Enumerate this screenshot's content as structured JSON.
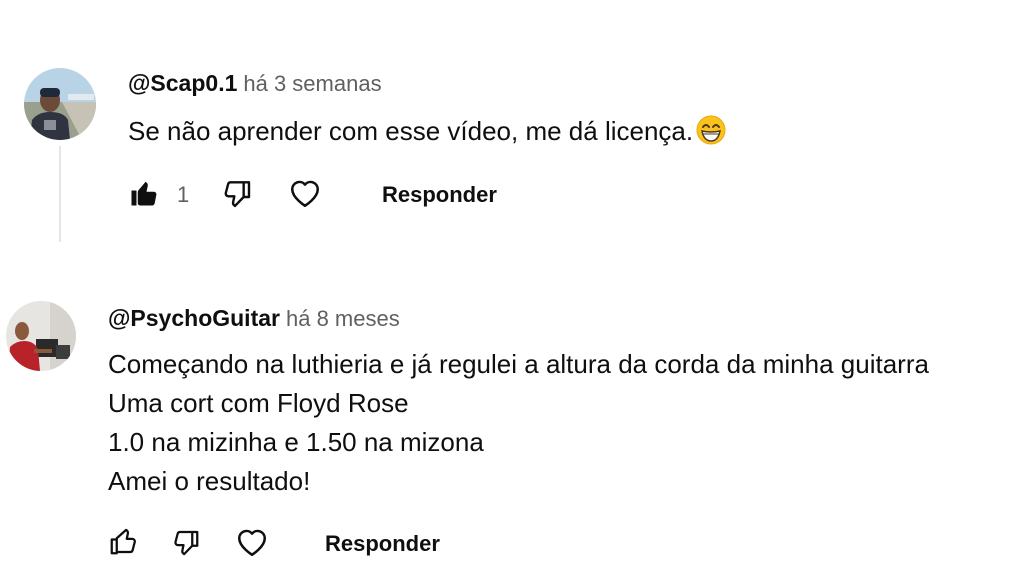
{
  "comments": [
    {
      "author": "@Scap0.1",
      "time": "há 3 semanas",
      "lines": [
        "Se não aprender com esse vídeo, me dá licença."
      ],
      "emoji": "grinning-face-with-smiling-eyes",
      "likes": "1",
      "liked": true,
      "reply_label": "Responder"
    },
    {
      "author": "@PsychoGuitar",
      "time": "há 8 meses",
      "lines": [
        "Começando na luthieria e já regulei a altura da corda da minha guitarra",
        "Uma cort com Floyd Rose",
        "1.0 na mizinha e 1.50 na mizona",
        "Amei o resultado!"
      ],
      "likes": "",
      "liked": false,
      "reply_label": "Responder"
    }
  ],
  "icons": {
    "like": "thumbs-up-icon",
    "dislike": "thumbs-down-icon",
    "heart": "heart-icon"
  },
  "colors": {
    "text": "#0f0f0f",
    "secondary": "#606060",
    "thread_line": "#e5e5e5"
  }
}
